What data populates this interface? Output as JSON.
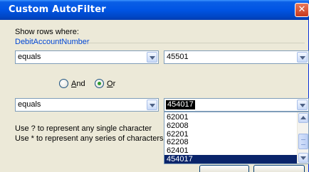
{
  "window": {
    "title": "Custom AutoFilter",
    "close_glyph": "✕"
  },
  "form": {
    "show_rows_label": "Show rows where:",
    "field_name": "DebitAccountNumber",
    "criteria1": {
      "operator": "equals",
      "value": "45501"
    },
    "logic": {
      "and_label_underlined": "A",
      "and_label_rest": "nd",
      "or_label_underlined": "O",
      "or_label_rest": "r",
      "selected": "Or"
    },
    "criteria2": {
      "operator": "equals",
      "value": "454017",
      "dropdown_items": [
        "62001",
        "62008",
        "62201",
        "62208",
        "62401",
        "454017"
      ],
      "selected_item": "454017"
    },
    "hint_single": "Use ? to represent any single character",
    "hint_series": "Use * to represent any series of characters"
  },
  "icons": {
    "dropdown": "chevron-down-icon",
    "scroll_up": "scroll-up-icon",
    "scroll_down": "scroll-down-icon"
  }
}
